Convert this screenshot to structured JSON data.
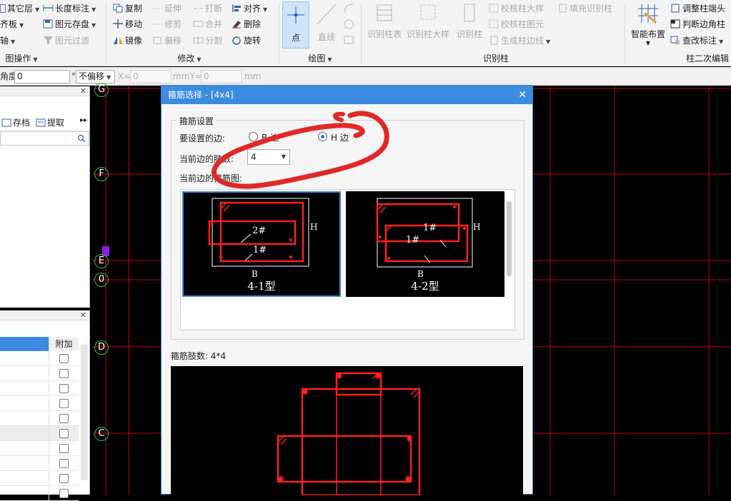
{
  "ribbon": {
    "left_items": [
      "其它层",
      "齐板",
      "轴"
    ],
    "col1": [
      "长度标注",
      "图元存盘",
      "图元过滤"
    ],
    "col2": [
      "复制",
      "移动",
      "镜像"
    ],
    "col3": [
      "延伸",
      "修剪",
      "偏移"
    ],
    "col4": [
      "打断",
      "合并",
      "分割"
    ],
    "col5": [
      "对齐",
      "删除",
      "旋转"
    ],
    "draw_point": "点",
    "draw_line": "直线",
    "identify_bigs": [
      "识别柱表",
      "识别柱大样",
      "识别柱"
    ],
    "identify_col": [
      "校核柱大样",
      "校核柱图元",
      "生成柱边线"
    ],
    "fill_identify": "填充识别柱",
    "smart_layout": "智能布置",
    "edit_col": [
      "调整柱端头",
      "判断边角柱",
      "查改标注"
    ],
    "groups": [
      "图操作",
      "修改",
      "绘图",
      "识别柱",
      "柱二次编辑"
    ]
  },
  "parambar": {
    "angle_label": "角度:",
    "angle_value": "0",
    "deg": "°",
    "offset_mode": "不偏移",
    "x_label": "X=",
    "x_value": "0",
    "y_label": "mmY=",
    "y_value": "0",
    "unit": "mm"
  },
  "leftpanel": {
    "save_btn": "存档",
    "extract_btn": "提取",
    "column_header": "附加",
    "checkbox_count": 10
  },
  "canvas": {
    "axes": [
      "G",
      "F",
      "E",
      "0",
      "D",
      "C"
    ]
  },
  "dialog": {
    "title": "箍筋选择 - [4x4]",
    "group_title": "箍筋设置",
    "side_label": "要设置的边:",
    "b_side": "B 边",
    "h_side": "H 边",
    "selected_side": "H",
    "count_label": "当前边的肢数:",
    "count_value": "4",
    "diagram_label": "当前边的箍筋图:",
    "thumbs": [
      {
        "label": "4-1型",
        "selected": true,
        "bar_a": "2#",
        "bar_b": "1#",
        "dim_b": "B",
        "dim_h": "H"
      },
      {
        "label": "4-2型",
        "selected": false,
        "bar_a": "1#",
        "bar_b": "1#",
        "dim_b": "B",
        "dim_h": "H"
      }
    ],
    "summary_label": "箍筋肢数: 4*4"
  },
  "colors": {
    "accent": "#3b8be0",
    "rebar": "#ff2020",
    "grid": "#e0001b",
    "annotation": "#e02828"
  }
}
